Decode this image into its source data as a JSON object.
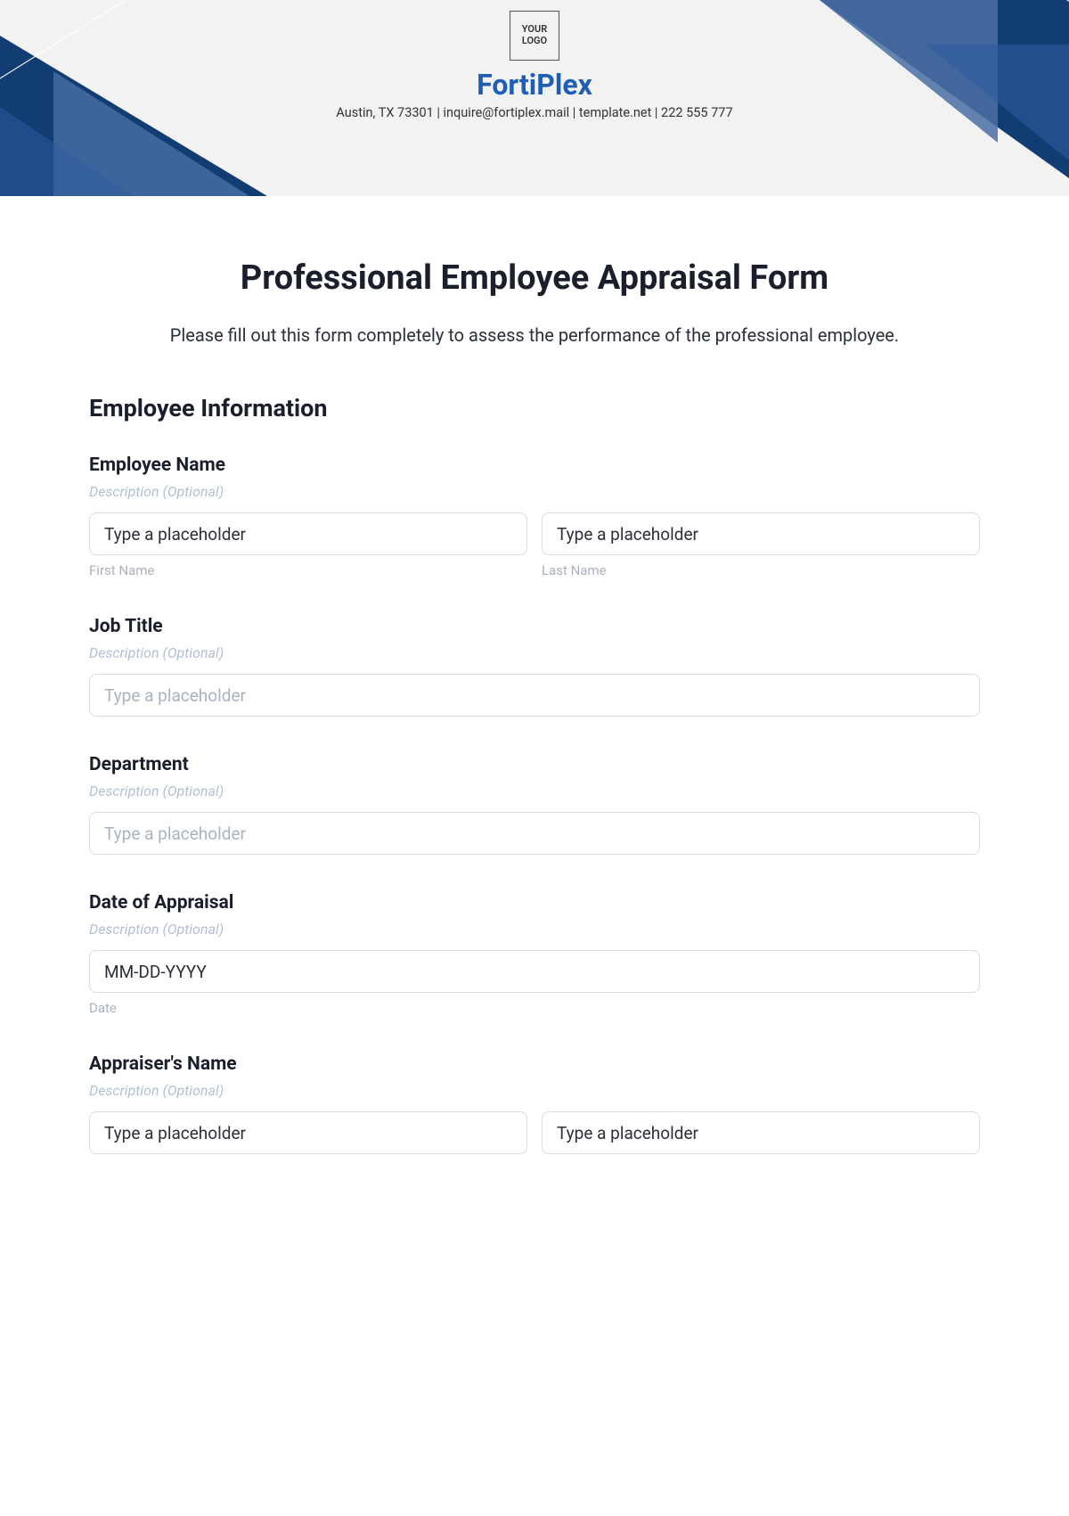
{
  "header": {
    "logo_text": "YOUR LOGO",
    "company": "FortiPlex",
    "info": "Austin, TX 73301 | inquire@fortiplex.mail | template.net | 222 555 777"
  },
  "form": {
    "title": "Professional Employee Appraisal Form",
    "subtitle": "Please fill out this form completely to assess the performance of the professional employee.",
    "section_title": "Employee Information",
    "desc_optional": "Description (Optional)",
    "placeholder_text": "Type a placeholder",
    "fields": {
      "employee_name": {
        "label": "Employee Name",
        "first_sub": "First Name",
        "last_sub": "Last Name",
        "first_value": "Type a placeholder",
        "last_value": "Type a placeholder"
      },
      "job_title": {
        "label": "Job Title"
      },
      "department": {
        "label": "Department"
      },
      "date_appraisal": {
        "label": "Date of Appraisal",
        "value": "MM-DD-YYYY",
        "sub": "Date"
      },
      "appraiser_name": {
        "label": "Appraiser's Name",
        "first_value": "Type a placeholder",
        "last_value": "Type a placeholder"
      }
    }
  }
}
